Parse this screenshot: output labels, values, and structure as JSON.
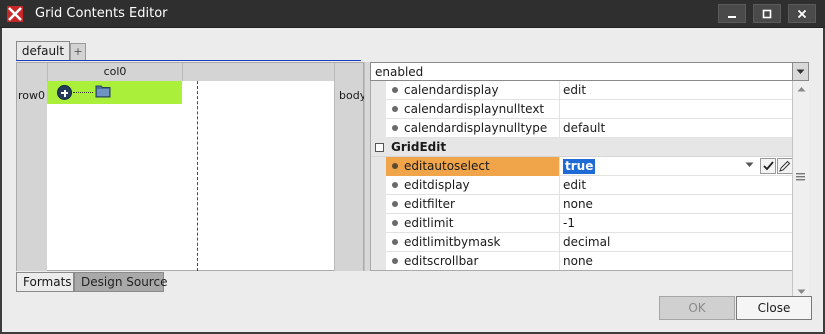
{
  "window": {
    "title": "Grid Contents Editor",
    "controls": [
      "minimize",
      "maximize",
      "close"
    ],
    "icon": "app-logo-icon"
  },
  "tabs": {
    "active": "default",
    "add_label": "+"
  },
  "grid": {
    "column_header": "col0",
    "row_header": "row0",
    "band_label": "body",
    "selected_cell_color": "#aaf03a"
  },
  "properties": {
    "selector_value": "enabled",
    "rows": [
      {
        "kind": "prop",
        "name": "calendardisplay",
        "value": "edit"
      },
      {
        "kind": "prop",
        "name": "calendardisplaynulltext",
        "value": ""
      },
      {
        "kind": "prop",
        "name": "calendardisplaynulltype",
        "value": "default"
      },
      {
        "kind": "category",
        "name": "GridEdit"
      },
      {
        "kind": "prop",
        "name": "editautoselect",
        "value": "true",
        "selected": true
      },
      {
        "kind": "prop",
        "name": "editdisplay",
        "value": "edit"
      },
      {
        "kind": "prop",
        "name": "editfilter",
        "value": "none"
      },
      {
        "kind": "prop",
        "name": "editlimit",
        "value": "-1"
      },
      {
        "kind": "prop",
        "name": "editlimitbymask",
        "value": "decimal"
      },
      {
        "kind": "prop",
        "name": "editscrollbar",
        "value": "none"
      }
    ],
    "selected_row_color": "#f0a54a"
  },
  "bottom_tabs": [
    "Formats",
    "Design Source"
  ],
  "buttons": {
    "ok": "OK",
    "close": "Close"
  }
}
